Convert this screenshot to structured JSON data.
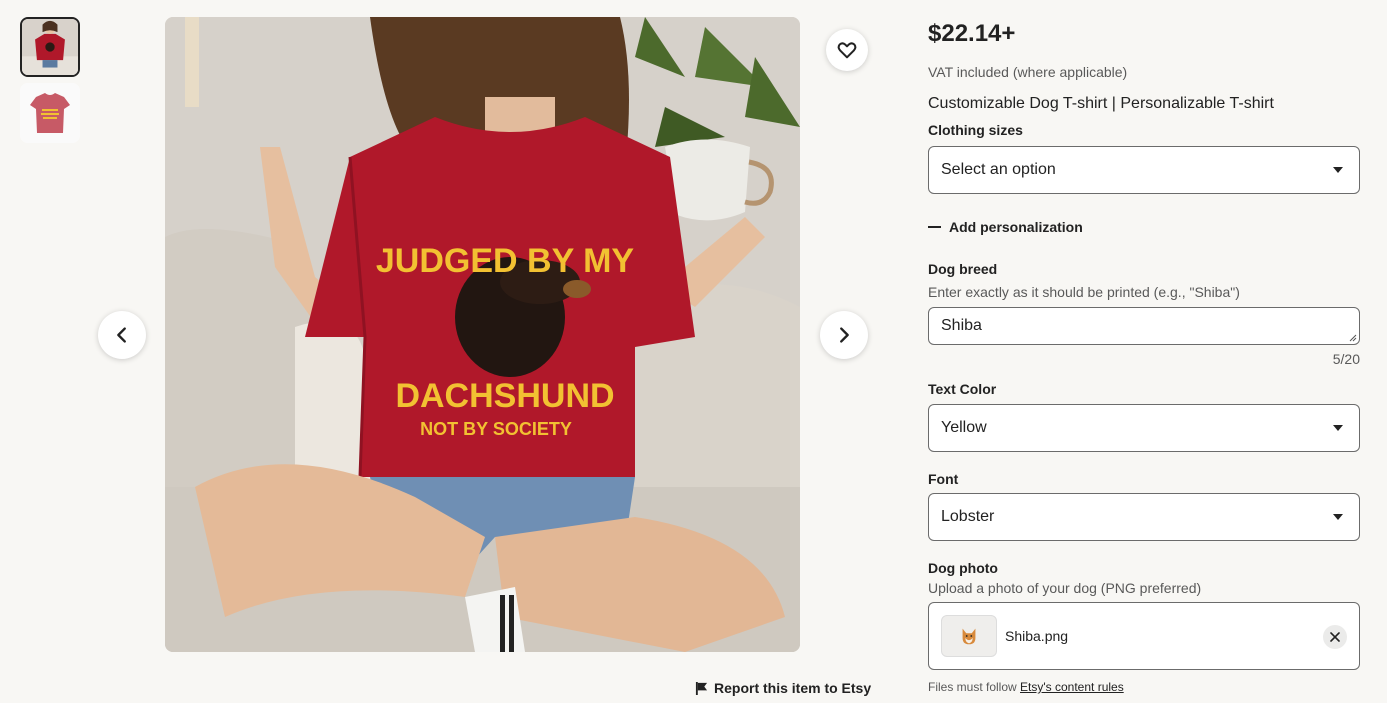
{
  "gallery": {
    "thumbnails": [
      "thumbnail-1",
      "thumbnail-2"
    ],
    "shirt_print": {
      "line1": "JUDGED BY MY",
      "line2": "DACHSHUND",
      "line3": "NOT BY SOCIETY"
    }
  },
  "report_label": "Report this item to Etsy",
  "listing": {
    "price": "$22.14+",
    "vat_note": "VAT included (where applicable)",
    "title": "Customizable Dog T-shirt | Personalizable T-shirt"
  },
  "sizes": {
    "label": "Clothing sizes",
    "value": "Select an option"
  },
  "personalization": {
    "toggle_label": "Add personalization"
  },
  "dog_breed": {
    "label": "Dog breed",
    "hint": "Enter exactly as it should be printed (e.g., \"Shiba\")",
    "value": "Shiba",
    "counter": "5/20"
  },
  "text_color": {
    "label": "Text Color",
    "value": "Yellow"
  },
  "font": {
    "label": "Font",
    "value": "Lobster"
  },
  "dog_photo": {
    "label": "Dog photo",
    "hint": "Upload a photo of your dog (PNG preferred)",
    "file_name": "Shiba.png"
  },
  "rules": {
    "prefix": "Files must follow ",
    "link": "Etsy's content rules"
  },
  "colors": {
    "shirt": "#b0182a",
    "print": "#f2c132",
    "border": "#6b6b6b"
  }
}
